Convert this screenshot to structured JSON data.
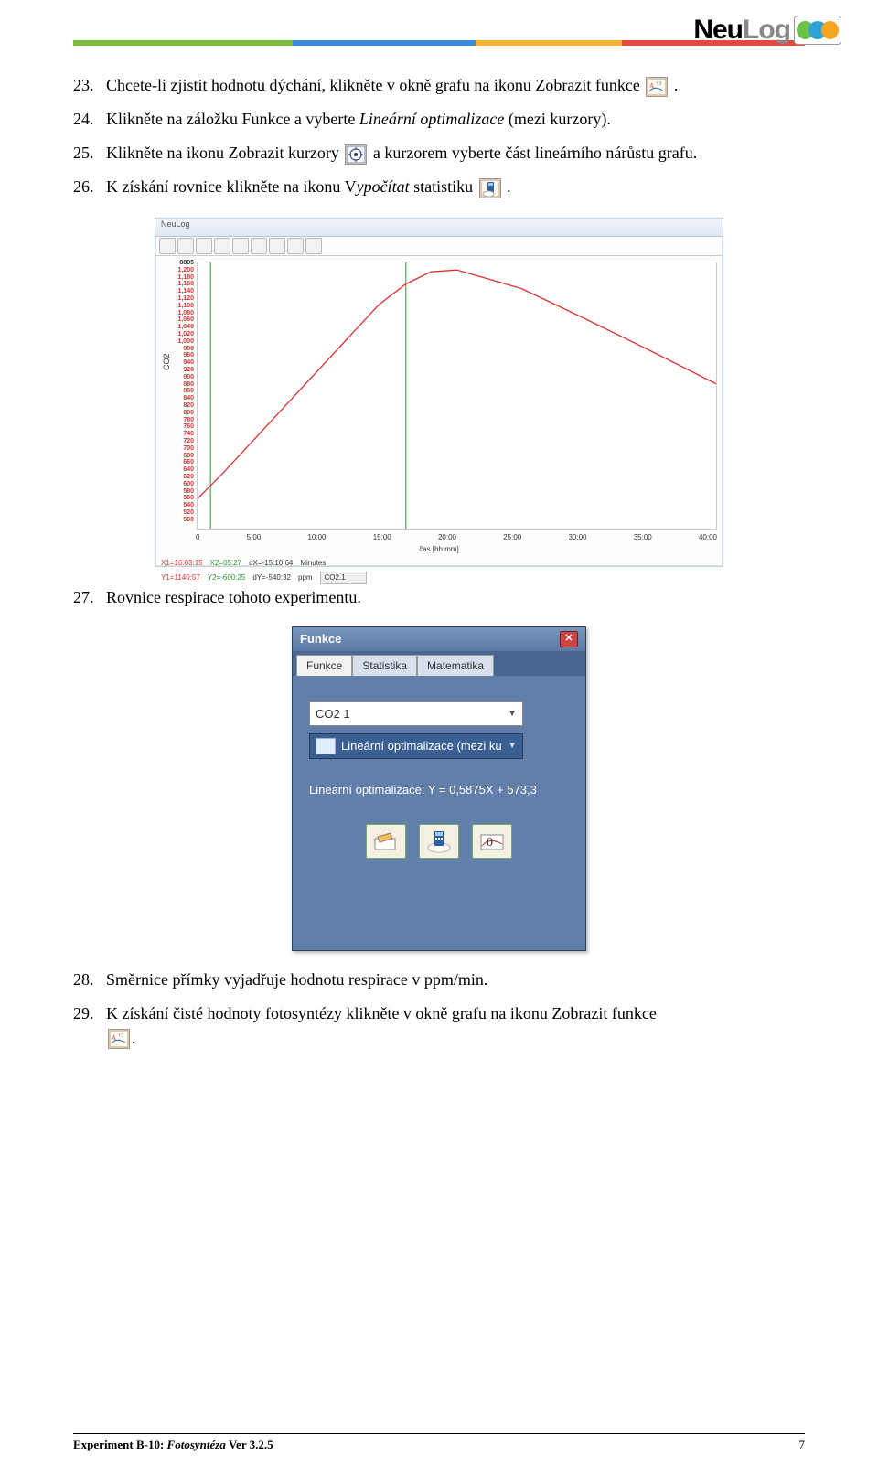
{
  "brand": {
    "prefix": "Neu",
    "suffix": "Log"
  },
  "steps": {
    "23": {
      "num": "23.",
      "text_a": "Chcete-li zjistit hodnotu dýchání, klikněte v okně grafu na ikonu Zobrazit funkce ",
      "text_b": "."
    },
    "24": {
      "num": "24.",
      "text_a": "Klikněte na záložku Funkce a vyberte ",
      "italic": "Lineární optimalizace",
      "text_b": " (mezi kurzory)."
    },
    "25": {
      "num": "25.",
      "text_a": "Klikněte na ikonu Zobrazit kurzory ",
      "text_b": " a kurzorem vyberte část lineárního nárůstu grafu."
    },
    "26": {
      "num": "26.",
      "text_a": "K získání rovnice klikněte na ikonu V",
      "italic": "ypočítat",
      "text_b": " statistiku ",
      "text_c": "."
    },
    "27": {
      "num": "27.",
      "text": "Rovnice respirace tohoto experimentu."
    },
    "28": {
      "num": "28.",
      "text": "Směrnice přímky vyjadřuje hodnotu respirace v ppm/min."
    },
    "29": {
      "num": "29.",
      "text_a": "K získání čisté hodnoty fotosyntézy klikněte v okně grafu na ikonu Zobrazit funkce",
      "text_b": "."
    }
  },
  "graph": {
    "app_title": "NeuLog",
    "y_label": "CO2",
    "y_ticks": [
      "8805",
      "1,200",
      "1,180",
      "1,160",
      "1,140",
      "1,120",
      "1,100",
      "1,080",
      "1,060",
      "1,040",
      "1,020",
      "1,000",
      "980",
      "960",
      "940",
      "920",
      "900",
      "880",
      "860",
      "840",
      "820",
      "800",
      "780",
      "760",
      "740",
      "720",
      "700",
      "680",
      "660",
      "640",
      "620",
      "600",
      "580",
      "560",
      "540",
      "520",
      "500"
    ],
    "x_ticks": [
      "0",
      "5:00",
      "10:00",
      "15:00",
      "20:00",
      "25:00",
      "30:00",
      "35:00",
      "40:00"
    ],
    "x_label": "čas [hh:mm]",
    "legend": {
      "x1": "X1=16:03:15",
      "x2": "X2=05:27",
      "dx": "dX=-15:10:64",
      "dx_unit": "Minutes",
      "y1": "Y1=1140:57",
      "y2": "Y2=-600:25",
      "dy": "dY=-540:32",
      "dy_unit": "ppm",
      "series": "CO2.1"
    }
  },
  "chart_data": {
    "type": "line",
    "title": "",
    "xlabel": "čas [hh:mm]",
    "ylabel": "CO2",
    "ylim": [
      500,
      1200
    ],
    "xlim": [
      0,
      40
    ],
    "series": [
      {
        "name": "CO2.1",
        "color": "#d33",
        "x": [
          0,
          2,
          5,
          8,
          11,
          14,
          16,
          18,
          20,
          25,
          30,
          35,
          40
        ],
        "y": [
          580,
          650,
          760,
          870,
          980,
          1090,
          1145,
          1175,
          1180,
          1130,
          1050,
          965,
          880
        ]
      }
    ],
    "cursors_x": [
      1,
      16
    ]
  },
  "dialog": {
    "title": "Funkce",
    "tabs": [
      "Funkce",
      "Statistika",
      "Matematika"
    ],
    "active_tab": 0,
    "select1": "CO2 1",
    "select2": "Lineární optimalizace (mezi ku",
    "equation": "Lineární optimalizace: Y = 0,5875X + 573,3"
  },
  "footer": {
    "left_a": "Experiment B-10: ",
    "left_b": "Fotosyntéza",
    "left_c": " Ver 3.2.5",
    "page": "7"
  }
}
